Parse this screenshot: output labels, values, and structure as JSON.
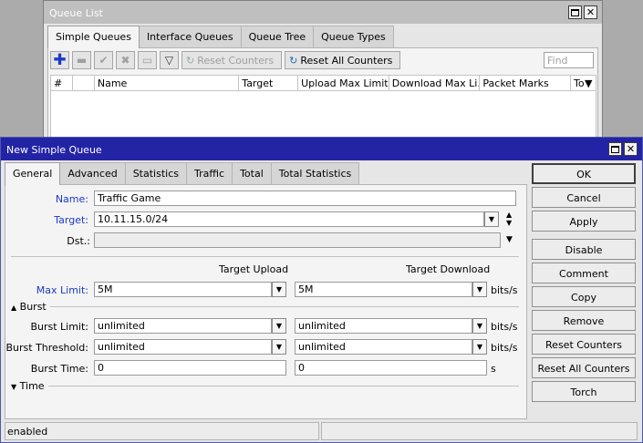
{
  "queue_list": {
    "title": "Queue List",
    "tabs": [
      "Simple Queues",
      "Interface Queues",
      "Queue Tree",
      "Queue Types"
    ],
    "toolbar": {
      "reset_counters": "Reset Counters",
      "reset_all_counters": "Reset All Counters",
      "find_placeholder": "Find"
    },
    "columns": [
      "#",
      "",
      "Name",
      "Target",
      "Upload Max Limit",
      "Download Max Li...",
      "Packet Marks",
      "To"
    ]
  },
  "new_queue": {
    "title": "New Simple Queue",
    "tabs": [
      "General",
      "Advanced",
      "Statistics",
      "Traffic",
      "Total",
      "Total Statistics"
    ],
    "form": {
      "name_label": "Name:",
      "name_value": "Traffic Game",
      "target_label": "Target:",
      "target_value": "10.11.15.0/24",
      "dst_label": "Dst.:",
      "dst_value": "",
      "target_upload_header": "Target Upload",
      "target_download_header": "Target Download",
      "max_limit_label": "Max Limit:",
      "max_limit_upload": "5M",
      "max_limit_download": "5M",
      "burst_section": "Burst",
      "burst_limit_label": "Burst Limit:",
      "burst_limit_upload": "unlimited",
      "burst_limit_download": "unlimited",
      "burst_threshold_label": "Burst Threshold:",
      "burst_threshold_upload": "unlimited",
      "burst_threshold_download": "unlimited",
      "burst_time_label": "Burst Time:",
      "burst_time_upload": "0",
      "burst_time_download": "0",
      "time_section": "Time",
      "unit_bits": "bits/s",
      "unit_seconds": "s"
    },
    "buttons": {
      "ok": "OK",
      "cancel": "Cancel",
      "apply": "Apply",
      "disable": "Disable",
      "comment": "Comment",
      "copy": "Copy",
      "remove": "Remove",
      "reset_counters": "Reset Counters",
      "reset_all_counters": "Reset All Counters",
      "torch": "Torch"
    },
    "status": "enabled"
  }
}
